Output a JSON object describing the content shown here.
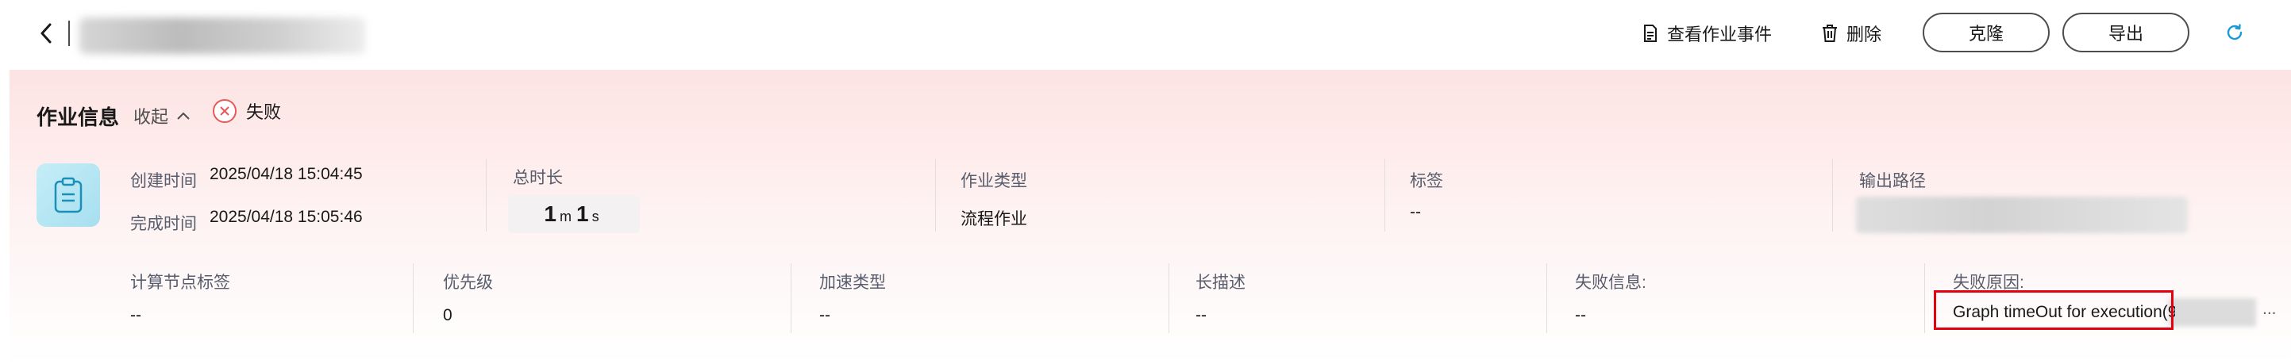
{
  "header": {
    "actions": {
      "view_events": "查看作业事件",
      "delete": "删除",
      "clone": "克隆",
      "export": "导出"
    },
    "icons": {
      "back": "chevron-left-icon",
      "events": "document-icon",
      "delete": "trash-icon",
      "refresh": "refresh-icon"
    }
  },
  "job_info": {
    "title": "作业信息",
    "collapse_label": "收起",
    "status": "失败",
    "created_label": "创建时间",
    "created_value": "2025/04/18 15:04:45",
    "completed_label": "完成时间",
    "completed_value": "2025/04/18 15:05:46",
    "duration_label": "总时长",
    "duration": {
      "min": "1",
      "min_unit": "m",
      "sec": "1",
      "sec_unit": "s"
    },
    "job_type_label": "作业类型",
    "job_type_value": "流程作业",
    "tags_label": "标签",
    "tags_value": "--",
    "output_path_label": "输出路径",
    "node_tags_label": "计算节点标签",
    "node_tags_value": "--",
    "priority_label": "优先级",
    "priority_value": "0",
    "accel_type_label": "加速类型",
    "accel_type_value": "--",
    "long_desc_label": "长描述",
    "long_desc_value": "--",
    "failure_info_label": "失败信息:",
    "failure_info_value": "--",
    "failure_reason_label": "失败原因:",
    "failure_reason_value": "Graph timeOut for execution(9",
    "failure_reason_ellipsis": "..."
  },
  "colors": {
    "accent_refresh": "#1a9bd8",
    "error": "#e85858",
    "highlight_box": "#e3000f",
    "panel_top": "#fde3e3"
  }
}
